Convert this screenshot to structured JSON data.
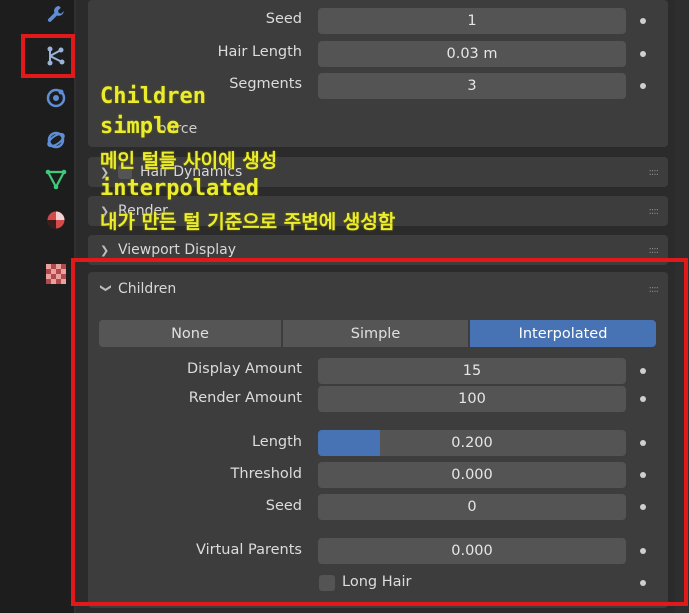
{
  "colors": {
    "accent": "#4772b3",
    "annotation": "#ecec2e",
    "highlight_box": "#e01a1a"
  },
  "properties_tabs": [
    {
      "name": "wrench-icon"
    },
    {
      "name": "particles-icon"
    },
    {
      "name": "physics-icon"
    },
    {
      "name": "constraints-icon"
    },
    {
      "name": "object-data-icon"
    },
    {
      "name": "material-icon"
    },
    {
      "name": "texture-icon"
    }
  ],
  "emission": {
    "seed_label": "Seed",
    "seed_value": "1",
    "hair_length_label": "Hair Length",
    "hair_length_value": "0.03 m",
    "segments_label": "Segments",
    "segments_value": "3"
  },
  "collapsed_sections": {
    "source_partial": "ource",
    "hair_dynamics": "Hair Dynamics",
    "render": "Render",
    "viewport_display": "Viewport Display"
  },
  "children": {
    "header": "Children",
    "modes": [
      "None",
      "Simple",
      "Interpolated"
    ],
    "active_mode": "Interpolated",
    "display_amount_label": "Display Amount",
    "display_amount_value": "15",
    "render_amount_label": "Render Amount",
    "render_amount_value": "100",
    "length_label": "Length",
    "length_value": "0.200",
    "length_fraction": 0.2,
    "threshold_label": "Threshold",
    "threshold_value": "0.000",
    "seed_label": "Seed",
    "seed_value": "0",
    "virtual_parents_label": "Virtual Parents",
    "virtual_parents_value": "0.000",
    "long_hair_label": "Long Hair"
  },
  "annotations": {
    "line1": "Children",
    "line2": "simple",
    "line3": "메인 털들 사이에 생성",
    "line4": "interpolated",
    "line5": "내가 만든 털 기준으로 주변에 생성함"
  }
}
